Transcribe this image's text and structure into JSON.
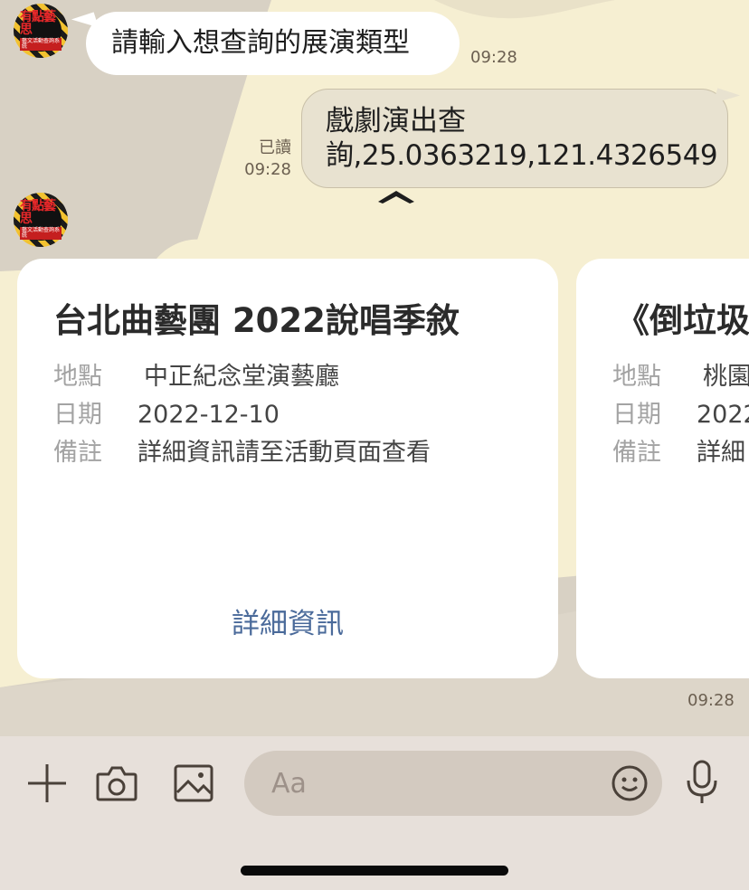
{
  "chat": {
    "messages": [
      {
        "text": "請輸入想查詢的展演類型",
        "time": "09:28"
      },
      {
        "line1": "戲劇演出查",
        "line2": "詢,25.0363219,121.4326549",
        "read": "已讀",
        "time": "09:28"
      }
    ],
    "avatar": {
      "line1": "有點藝思",
      "line2": "藝文活動查詢系統"
    }
  },
  "carousel": {
    "cards": [
      {
        "title": "台北曲藝團 2022說唱季敘",
        "location_label": "地點",
        "location": "中正紀念堂演藝廳",
        "date_label": "日期",
        "date": "2022-12-10",
        "note_label": "備註",
        "note": "詳細資訊請至活動頁面查看",
        "link": "詳細資訊"
      },
      {
        "title": "《倒垃圾",
        "location_label": "地點",
        "location": "桃園",
        "date_label": "日期",
        "date": "2022",
        "note_label": "備註",
        "note": "詳細"
      }
    ],
    "time": "09:28"
  },
  "input": {
    "placeholder": "Aa",
    "icons": [
      "plus-icon",
      "camera-icon",
      "image-icon",
      "emoji-icon",
      "microphone-icon"
    ]
  },
  "colors": {
    "chat_bg_beige": "#f6efd2",
    "chat_bg_gray": "#d8d1c4",
    "card_link": "#4a6a9a",
    "toolbar_bg": "#e7e0da"
  }
}
